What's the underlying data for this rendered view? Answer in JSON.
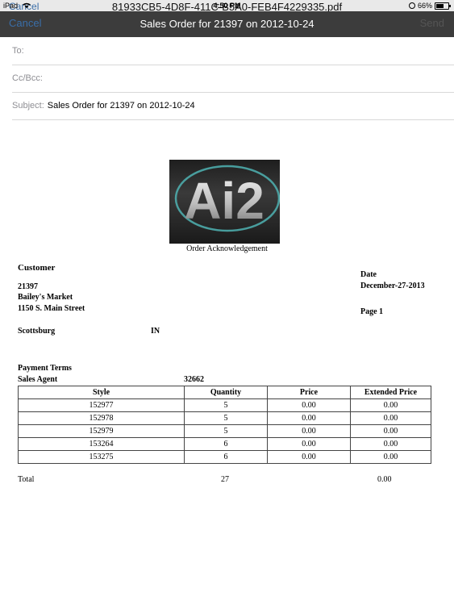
{
  "status_bar": {
    "carrier": "iPad",
    "time": "4:50 PM",
    "battery": "66%",
    "battery_level": 0.66
  },
  "viewer": {
    "filename": "81933CB5-4D8F-411C-B5A0-FEB4F4229335.pdf",
    "cancel_label": "Cancel"
  },
  "compose": {
    "cancel_label": "Cancel",
    "title": "Sales Order for 21397 on 2012-10-24",
    "send_label": "Send",
    "to_label": "To:",
    "to_value": "",
    "ccbcc_label": "Cc/Bcc:",
    "ccbcc_value": "",
    "subject_label": "Subject:",
    "subject_value": "Sales Order for 21397 on 2012-10-24"
  },
  "document": {
    "logo_text": "Ai2",
    "heading": "Order Acknowledgement",
    "customer_label": "Customer",
    "customer_id": "21397",
    "customer_name": "Bailey's Market",
    "address_line": "1150 S. Main Street",
    "city": "Scottsburg",
    "state": "IN",
    "date_label": "Date",
    "date_value": "December-27-2013",
    "page_label": "Page 1",
    "payment_terms_label": "Payment Terms",
    "sales_agent_label": "Sales Agent",
    "sales_agent_value": "32662",
    "table": {
      "headers": [
        "Style",
        "Quantity",
        "Price",
        "Extended Price"
      ],
      "rows": [
        [
          "152977",
          "5",
          "0.00",
          "0.00"
        ],
        [
          "152978",
          "5",
          "0.00",
          "0.00"
        ],
        [
          "152979",
          "5",
          "0.00",
          "0.00"
        ],
        [
          "153264",
          "6",
          "0.00",
          "0.00"
        ],
        [
          "153275",
          "6",
          "0.00",
          "0.00"
        ]
      ]
    },
    "total_label": "Total",
    "total_quantity": "27",
    "total_price": "0.00"
  }
}
